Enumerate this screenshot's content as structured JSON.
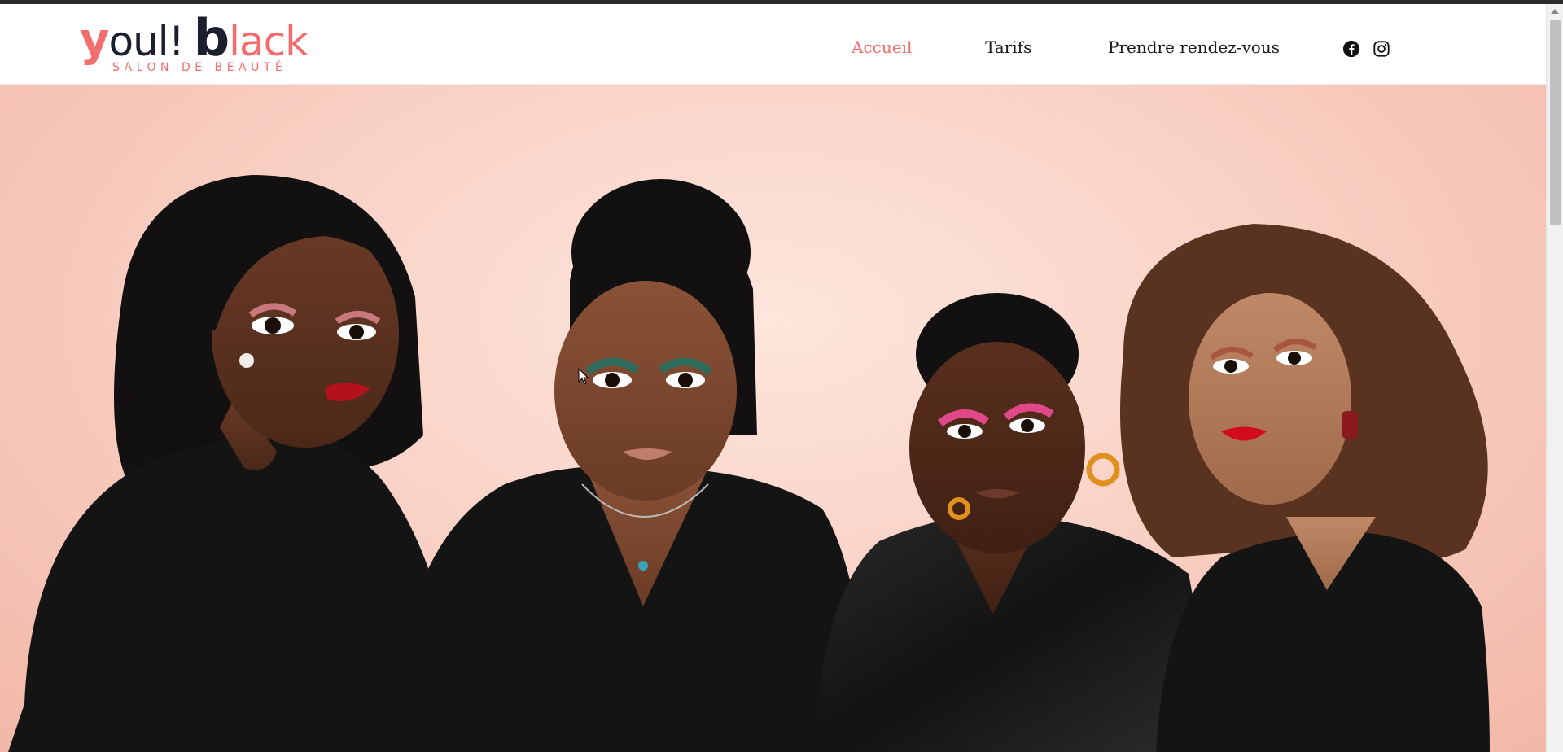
{
  "logo": {
    "part_y": "y",
    "part_oul": "oul!",
    "part_b": "b",
    "part_lack": "lack",
    "tagline": "SALON DE BEAUTÉ"
  },
  "nav": {
    "items": [
      {
        "label": "Accueil",
        "active": true
      },
      {
        "label": "Tarifs",
        "active": false
      },
      {
        "label": "Prendre rendez-vous",
        "active": false
      }
    ]
  },
  "social": {
    "facebook_icon": "facebook-icon",
    "instagram_icon": "instagram-icon"
  },
  "hero": {
    "image_subject": "four-women-group-photo"
  },
  "colors": {
    "accent": "#f26d6d",
    "brand_dark": "#1c1f2e",
    "hero_background": "#f9d2c6",
    "clothing": "#141414"
  }
}
